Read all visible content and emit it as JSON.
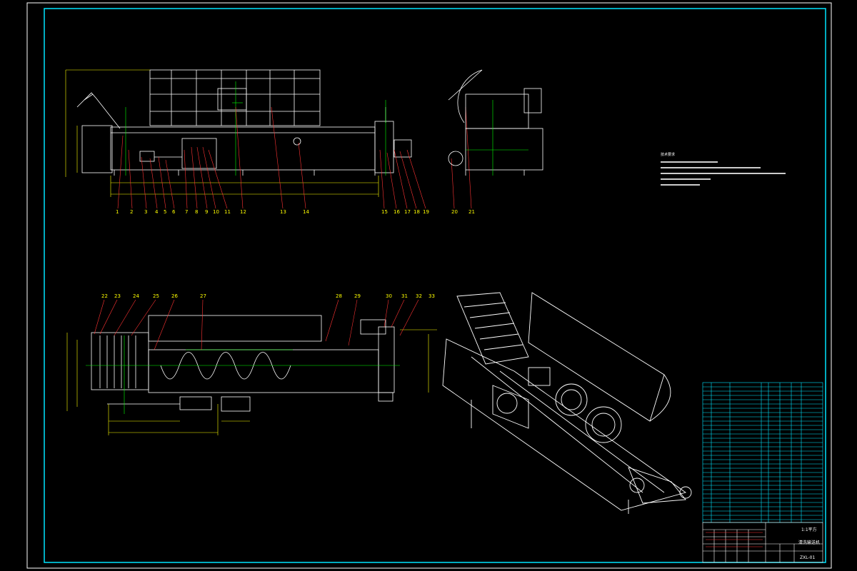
{
  "drawing": {
    "scale_note": "1:1平方",
    "drawing_title": "清洗输送机",
    "drawing_no": "ZXL-01",
    "tech_requirements_title": "技术要求"
  },
  "callouts_front": [
    "1",
    "2",
    "3",
    "4",
    "5",
    "6",
    "7",
    "8",
    "9",
    "10",
    "11",
    "12",
    "13",
    "14",
    "15",
    "16",
    "17",
    "18",
    "19",
    "20",
    "21"
  ],
  "callouts_plan": [
    "22",
    "23",
    "24",
    "25",
    "26",
    "27",
    "28",
    "29",
    "30",
    "31",
    "32",
    "33"
  ],
  "colors": {
    "frame_outer": "#ffffff",
    "frame_inner": "#00e5ff",
    "geometry": "#ffffff",
    "dimension": "#ffff00",
    "leader": "#ff3333",
    "centerline": "#00ff00",
    "magenta": "#ff33ff",
    "table_line": "#00e5ff"
  }
}
